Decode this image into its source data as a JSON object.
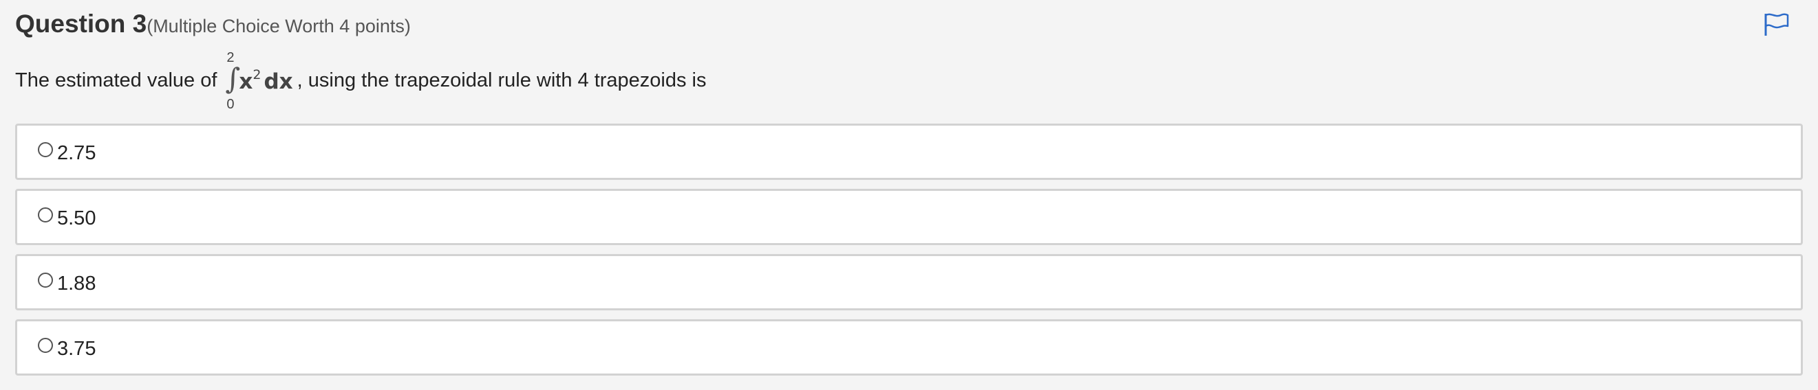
{
  "question": {
    "title": "Question 3",
    "points_note": "(Multiple Choice Worth 4 points)",
    "prompt_before": "The estimated value of",
    "integral": {
      "upper": "2",
      "lower": "0",
      "sign": "∫",
      "base": "x",
      "exponent": "2",
      "differential": "dx"
    },
    "prompt_after": ", using the trapezoidal rule with 4 trapezoids is"
  },
  "flag": {
    "icon": "flag-icon",
    "color": "#2d6bc9"
  },
  "options": [
    {
      "label": "2.75",
      "selected": false
    },
    {
      "label": "5.50",
      "selected": false
    },
    {
      "label": "1.88",
      "selected": false
    },
    {
      "label": "3.75",
      "selected": false
    }
  ]
}
